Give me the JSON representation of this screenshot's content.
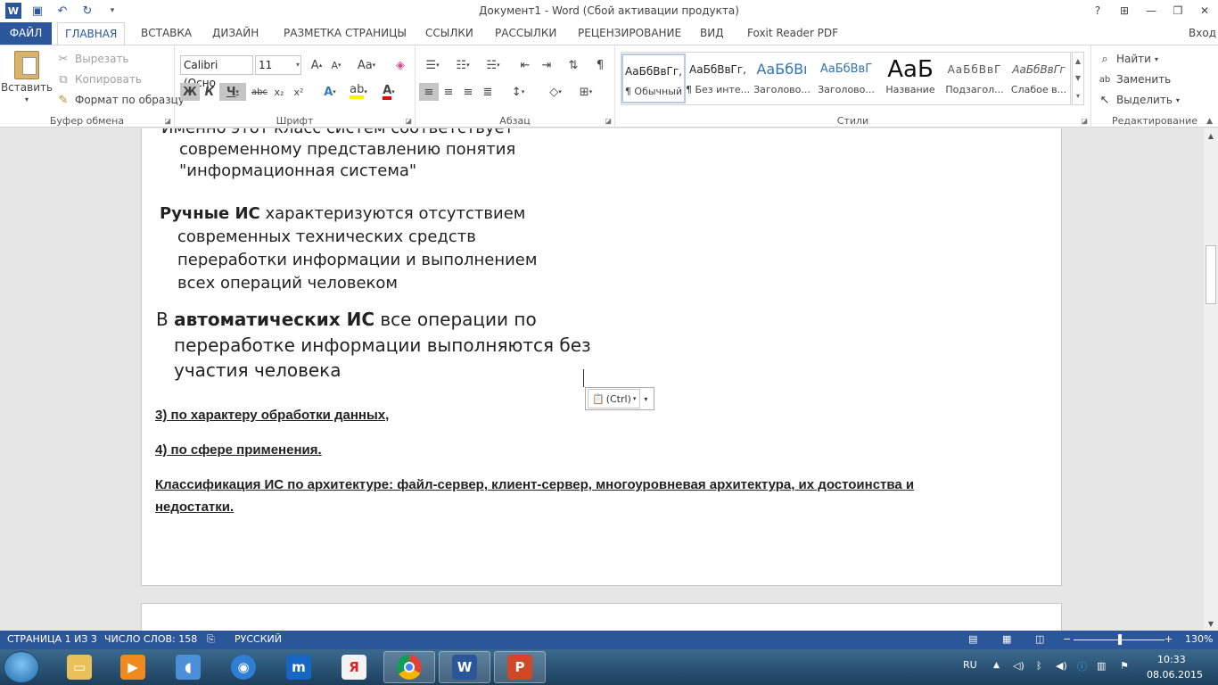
{
  "titlebar": {
    "title": "Документ1 - Word (Сбой активации продукта)",
    "qat": [
      "word-logo-icon",
      "save-icon",
      "undo-icon",
      "redo-icon",
      "customize-icon"
    ],
    "controls": {
      "help": "?",
      "ribbon_opts": "⊞",
      "minimize": "—",
      "restore": "❐",
      "close": "✕"
    }
  },
  "tabs": {
    "file": "ФАЙЛ",
    "items": [
      "ГЛАВНАЯ",
      "ВСТАВКА",
      "ДИЗАЙН",
      "РАЗМЕТКА СТРАНИЦЫ",
      "ССЫЛКИ",
      "РАССЫЛКИ",
      "РЕЦЕНЗИРОВАНИЕ",
      "ВИД",
      "Foxit Reader PDF"
    ],
    "active": "ГЛАВНАЯ",
    "login": "Вход"
  },
  "clipboard": {
    "label": "Буфер обмена",
    "paste": "Вставить",
    "cut": "Вырезать",
    "copy": "Копировать",
    "format_painter": "Формат по образцу"
  },
  "font": {
    "label": "Шрифт",
    "name": "Calibri (Осно",
    "size": "11",
    "grow": "A",
    "shrink": "A",
    "case": "Aa",
    "bold": "Ж",
    "italic": "К",
    "underline": "Ч",
    "strike": "abc",
    "subscript": "x₂",
    "superscript": "x²"
  },
  "paragraph": {
    "label": "Абзац"
  },
  "styles": {
    "label": "Стили",
    "items": [
      {
        "preview": "АаБбВвГг,",
        "name": "¶ Обычный"
      },
      {
        "preview": "АаБбВвГг,",
        "name": "¶ Без инте..."
      },
      {
        "preview": "АаБбВı",
        "name": "Заголово..."
      },
      {
        "preview": "АаБбВвГ",
        "name": "Заголово..."
      },
      {
        "preview": "АаБ",
        "name": "Название"
      },
      {
        "preview": "АаБбВвГ",
        "name": "Подзагол..."
      },
      {
        "preview": "АаБбВвГг",
        "name": "Слабое в..."
      }
    ]
  },
  "editing": {
    "label": "Редактирование",
    "find": "Найти",
    "replace": "Заменить",
    "select": "Выделить"
  },
  "document": {
    "slide_lines": [
      "Именно этот класс систем соответствует",
      "современному представлению понятия",
      "\"информационная система\""
    ],
    "manual": {
      "bold": "Ручные ИС",
      "rest": " характеризуются отсутствием",
      "lines": [
        "современных технических средств",
        "переработки информации и выполнением",
        "всех операций человеком"
      ]
    },
    "auto": {
      "prefix": "В ",
      "bold": "автоматических ИС",
      "rest": " все операции по",
      "lines": [
        "переработке информации выполняются без",
        "участия человека"
      ]
    },
    "heading3": "3) по характеру обработки данных,",
    "heading4": "4) по сфере применения.",
    "heading_class_1": "Классификация ИС по архитектуре: файл-сервер, клиент-сервер, многоуровневая архитектура, их достоинства и",
    "heading_class_2": "недостатки.",
    "paste_options": "(Ctrl)"
  },
  "statusbar": {
    "page": "СТРАНИЦА 1 ИЗ 3",
    "words": "ЧИСЛО СЛОВ: 158",
    "language": "РУССКИЙ",
    "zoom": "130%",
    "zoom_value": 1.3
  },
  "taskbar": {
    "apps": [
      "explorer-icon",
      "media-player-icon",
      "speaker-app-icon",
      "globe-icon",
      "maxthon-icon",
      "yandex-icon",
      "chrome-icon",
      "word-icon",
      "powerpoint-icon"
    ],
    "tray": {
      "lang": "RU",
      "time": "10:33",
      "date": "08.06.2015"
    }
  }
}
